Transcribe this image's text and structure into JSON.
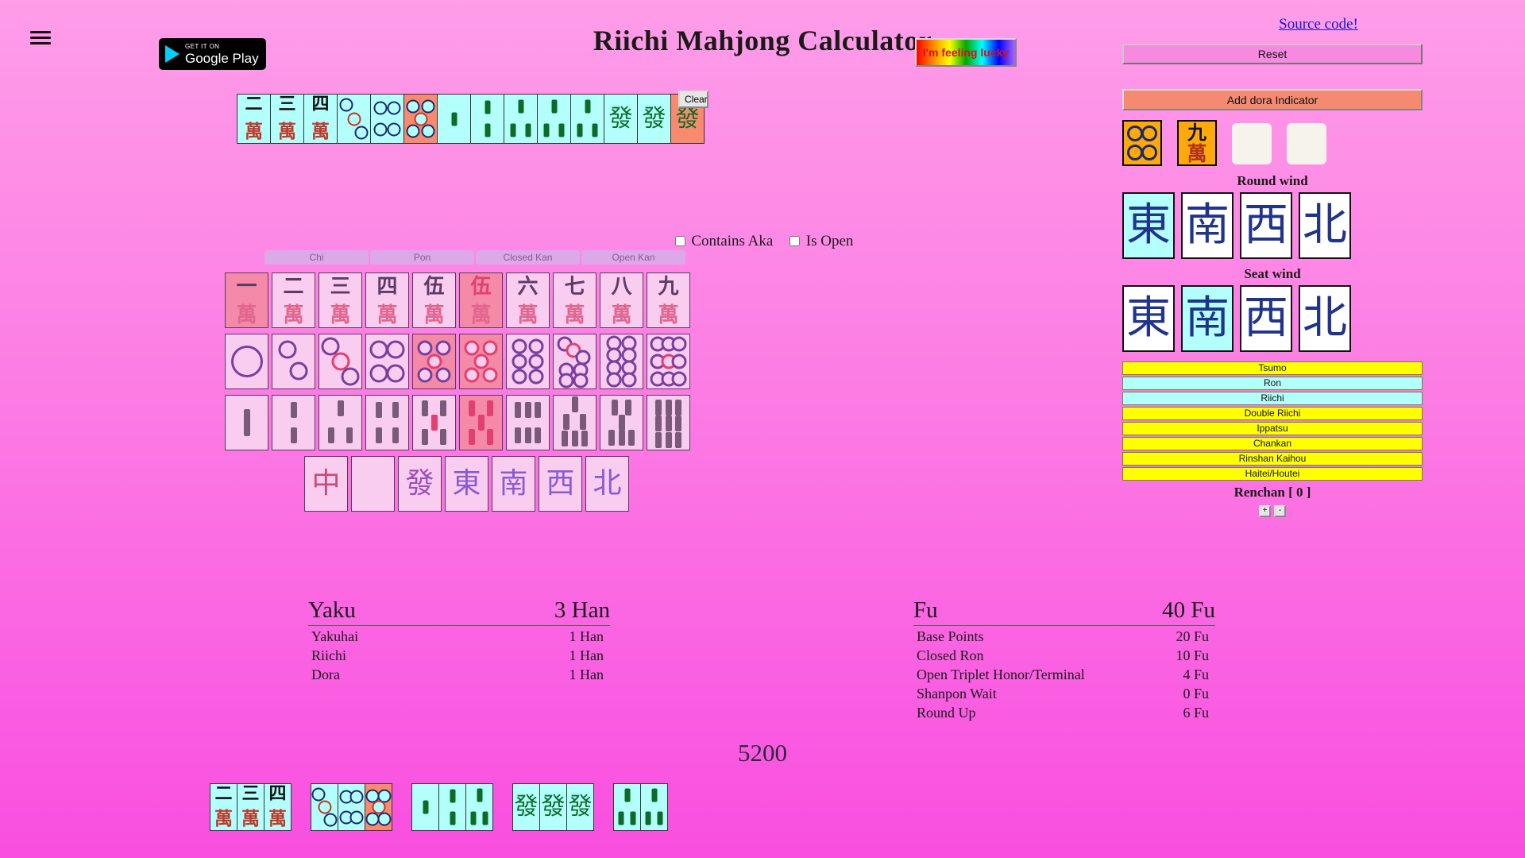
{
  "header": {
    "title": "Riichi Mahjong Calculator",
    "menu_icon": "hamburger-icon",
    "gplay_small": "GET IT ON",
    "gplay_big": "Google Play",
    "lucky_label": "I'm feeling lucky",
    "source_link": "Source code!"
  },
  "hand": {
    "clear_label": "Clear",
    "tiles": [
      {
        "kind": "man",
        "num": "2",
        "suit": "萬",
        "selected": false
      },
      {
        "kind": "man",
        "num": "3",
        "suit": "萬",
        "selected": false
      },
      {
        "kind": "man",
        "num": "4",
        "suit": "萬",
        "selected": false
      },
      {
        "kind": "pin",
        "num": "3",
        "selected": false
      },
      {
        "kind": "pin",
        "num": "4",
        "selected": false
      },
      {
        "kind": "pin",
        "num": "5",
        "selected": true
      },
      {
        "kind": "sou",
        "num": "1",
        "selected": false
      },
      {
        "kind": "sou",
        "num": "2",
        "selected": false
      },
      {
        "kind": "sou",
        "num": "3",
        "selected": false
      },
      {
        "kind": "sou",
        "num": "3",
        "selected": false
      },
      {
        "kind": "sou",
        "num": "3",
        "selected": false
      },
      {
        "kind": "honor",
        "glyph": "發",
        "selected": false
      },
      {
        "kind": "honor",
        "glyph": "發",
        "selected": false
      },
      {
        "kind": "honor",
        "glyph": "發",
        "selected": true
      }
    ]
  },
  "options": {
    "contains_aka_label": "Contains Aka",
    "contains_aka_checked": false,
    "is_open_label": "Is Open",
    "is_open_checked": false,
    "melds": [
      "Chi",
      "Pon",
      "Closed Kan",
      "Open Kan"
    ]
  },
  "selector": {
    "man_row": [
      {
        "num": "一",
        "disabled": true
      },
      {
        "num": "二",
        "disabled": false
      },
      {
        "num": "三",
        "disabled": false
      },
      {
        "num": "四",
        "disabled": false
      },
      {
        "num": "伍",
        "disabled": false
      },
      {
        "num": "伍",
        "red": true,
        "disabled": true
      },
      {
        "num": "六",
        "disabled": false
      },
      {
        "num": "七",
        "disabled": false
      },
      {
        "num": "八",
        "disabled": false
      },
      {
        "num": "九",
        "disabled": false
      }
    ],
    "pin_row": [
      {
        "n": 1,
        "disabled": false
      },
      {
        "n": 2,
        "disabled": false
      },
      {
        "n": 3,
        "disabled": false
      },
      {
        "n": 4,
        "disabled": false
      },
      {
        "n": 5,
        "disabled": true
      },
      {
        "n": 5,
        "red": true,
        "disabled": true
      },
      {
        "n": 6,
        "disabled": false
      },
      {
        "n": 7,
        "disabled": false
      },
      {
        "n": 8,
        "disabled": false
      },
      {
        "n": 9,
        "disabled": false
      }
    ],
    "sou_row": [
      {
        "n": 1,
        "disabled": false
      },
      {
        "n": 2,
        "disabled": false
      },
      {
        "n": 3,
        "disabled": false
      },
      {
        "n": 4,
        "disabled": false
      },
      {
        "n": 5,
        "disabled": false
      },
      {
        "n": 5,
        "red": true,
        "disabled": true
      },
      {
        "n": 6,
        "disabled": false
      },
      {
        "n": 7,
        "disabled": false
      },
      {
        "n": 8,
        "disabled": false
      },
      {
        "n": 9,
        "disabled": false
      }
    ],
    "honor_row": [
      {
        "glyph": "中",
        "color": "red"
      },
      {
        "glyph": "",
        "color": "blank"
      },
      {
        "glyph": "發",
        "color": "green"
      },
      {
        "glyph": "東",
        "color": "purple"
      },
      {
        "glyph": "南",
        "color": "purple"
      },
      {
        "glyph": "西",
        "color": "purple"
      },
      {
        "glyph": "北",
        "color": "purple"
      }
    ]
  },
  "right": {
    "reset_label": "Reset",
    "add_dora_label": "Add dora Indicator",
    "dora": [
      {
        "kind": "pin",
        "num": "4",
        "filled": true
      },
      {
        "kind": "man",
        "num": "九",
        "filled": true
      },
      {
        "kind": "empty"
      },
      {
        "kind": "empty"
      }
    ],
    "round_wind_label": "Round wind",
    "round_winds": [
      {
        "glyph": "東",
        "active": true
      },
      {
        "glyph": "南",
        "active": false
      },
      {
        "glyph": "西",
        "active": false
      },
      {
        "glyph": "北",
        "active": false
      }
    ],
    "seat_wind_label": "Seat wind",
    "seat_winds": [
      {
        "glyph": "東",
        "active": false
      },
      {
        "glyph": "南",
        "active": true
      },
      {
        "glyph": "西",
        "active": false
      },
      {
        "glyph": "北",
        "active": false
      }
    ],
    "yaku_buttons": [
      {
        "label": "Tsumo",
        "on": false
      },
      {
        "label": "Ron",
        "on": true
      },
      {
        "label": "Riichi",
        "on": true
      },
      {
        "label": "Double Riichi",
        "on": false
      },
      {
        "label": "Ippatsu",
        "on": false
      },
      {
        "label": "Chankan",
        "on": false
      },
      {
        "label": "Rinshan Kaihou",
        "on": false
      },
      {
        "label": "Haitei/Houtei",
        "on": false
      }
    ],
    "renchan_label": "Renchan [ 0 ]",
    "renchan_plus": "+",
    "renchan_minus": "-"
  },
  "results": {
    "yaku_title": "Yaku",
    "yaku_total": "3 Han",
    "yaku_rows": [
      {
        "name": "Yakuhai",
        "value": "1 Han"
      },
      {
        "name": "Riichi",
        "value": "1 Han"
      },
      {
        "name": "Dora",
        "value": "1 Han"
      }
    ],
    "fu_title": "Fu",
    "fu_total": "40 Fu",
    "fu_rows": [
      {
        "name": "Base Points",
        "value": "20 Fu"
      },
      {
        "name": "Closed Ron",
        "value": "10 Fu"
      },
      {
        "name": "Open Triplet Honor/Terminal",
        "value": "4 Fu"
      },
      {
        "name": "Shanpon Wait",
        "value": "0 Fu"
      },
      {
        "name": "Round Up",
        "value": "6 Fu"
      }
    ],
    "score": "5200",
    "result_groups": [
      [
        {
          "kind": "man",
          "num": "2"
        },
        {
          "kind": "man",
          "num": "3"
        },
        {
          "kind": "man",
          "num": "4"
        }
      ],
      [
        {
          "kind": "pin",
          "num": "3"
        },
        {
          "kind": "pin",
          "num": "4"
        },
        {
          "kind": "pin",
          "num": "5",
          "selected": true
        }
      ],
      [
        {
          "kind": "sou",
          "num": "1"
        },
        {
          "kind": "sou",
          "num": "2"
        },
        {
          "kind": "sou",
          "num": "3"
        }
      ],
      [
        {
          "kind": "honor",
          "glyph": "發"
        },
        {
          "kind": "honor",
          "glyph": "發"
        },
        {
          "kind": "honor",
          "glyph": "發"
        }
      ],
      [
        {
          "kind": "sou",
          "num": "3"
        },
        {
          "kind": "sou",
          "num": "3"
        }
      ]
    ]
  }
}
